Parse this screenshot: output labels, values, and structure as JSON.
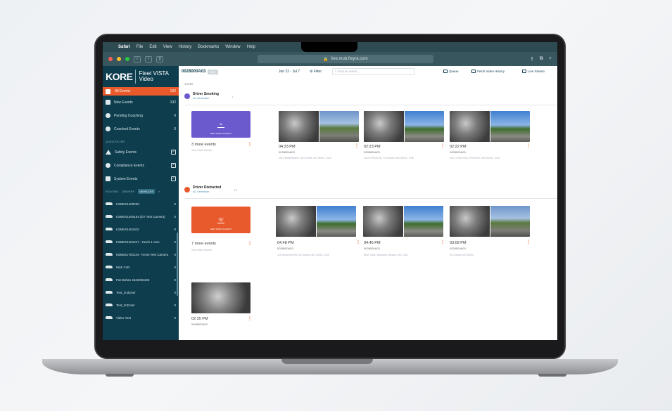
{
  "browser": {
    "menu": [
      "Safari",
      "File",
      "Edit",
      "View",
      "History",
      "Bookmarks",
      "Window",
      "Help"
    ],
    "url": "live.mub.fleyra.com"
  },
  "brand": {
    "logo": "KORE",
    "product_line1": "Fleet VISTA",
    "product_line2": "Video"
  },
  "sidebar": {
    "all_events": {
      "label": "All Events",
      "count": "192"
    },
    "nav": [
      {
        "label": "New Events",
        "count": "192",
        "icon": "bell-icon"
      },
      {
        "label": "Pending Coaching",
        "count": "0",
        "icon": "question-icon"
      },
      {
        "label": "Coached Events",
        "count": "0",
        "icon": "check-circle-icon"
      }
    ],
    "quick_filter_label": "QUICK FILTER",
    "quick_filters": [
      {
        "label": "Safety Events",
        "checked": true
      },
      {
        "label": "Compliance Events",
        "checked": true
      },
      {
        "label": "System Events",
        "checked": true
      }
    ],
    "filter_tabs": [
      "ROUTING",
      "DRIVERS",
      "VEHICLES"
    ],
    "vehicles": [
      {
        "name": "K2MEX1400259",
        "count": "0"
      },
      {
        "name": "K2MEX1400164 (DT Test Camera)",
        "count": "0"
      },
      {
        "name": "K2MEX1401102",
        "count": "0"
      },
      {
        "name": "K2MEX1401217 - Kevin 1 cam",
        "count": "0"
      },
      {
        "name": "K5MB41703134 - Kevin Test Camera",
        "count": "0"
      },
      {
        "name": "Mick C4D",
        "count": "0"
      },
      {
        "name": "Pat Bohan 4532098435",
        "count": "0"
      },
      {
        "name": "Test_2ndUser",
        "count": "0"
      },
      {
        "name": "Test_3rdUser",
        "count": "0"
      },
      {
        "name": "Video Test",
        "count": "0"
      }
    ]
  },
  "main": {
    "vehicle_id": "0028000A03",
    "vehicle_tag": "ADX",
    "date_range": "Jun 22 - Jul 7",
    "filter_label": "Filter",
    "search_placeholder": "Find an event...",
    "actions": [
      "Queue",
      "Fetch Video History",
      "Live Stream"
    ],
    "date_header": "Jul 29",
    "sections": [
      {
        "title": "Driver Smoking",
        "subtitle": "Ai1 Generation",
        "count": "1",
        "group_caption": "NEW VIDEO 4 EVENT",
        "more": "3 more events",
        "more_sub": "View Older Events",
        "events": [
          {
            "time": "04:33 PM",
            "vehicle": "0028000A03",
            "address": "1516 Bellefontaine, St Charles, MO 63301, USA"
          },
          {
            "time": "02:23 PM",
            "vehicle": "0028000A03",
            "address": "1611 S River Rd, St Charles, MO 63301, USA"
          },
          {
            "time": "02:22 PM",
            "vehicle": "0028000A03",
            "address": "1611 S River Rd, St Charles, MO 63301, USA"
          }
        ]
      },
      {
        "title": "Driver Distracted",
        "subtitle": "Ai1 Generation",
        "count": "13",
        "group_caption": "NEW VIDEO 4 EVENT",
        "more": "7 more events",
        "more_sub": "View Older Events",
        "events": [
          {
            "time": "04:48 PM",
            "vehicle": "0028000A03",
            "address": "118 Timberline Rd, St Charles, MO 63301, USA"
          },
          {
            "time": "04:45 PM",
            "vehicle": "0028000A03",
            "address": "Bent Trails, Maryland Heights, MO, USA"
          },
          {
            "time": "03:09 PM",
            "vehicle": "0028000A03",
            "address": "St Charles, MO 63301"
          }
        ],
        "extra": {
          "time": "02:35 PM",
          "vehicle": "0028000A03"
        }
      }
    ]
  },
  "colors": {
    "sidebar": "#0e3d4e",
    "accent": "#e85a2c",
    "smoking": "#6a5acd"
  }
}
